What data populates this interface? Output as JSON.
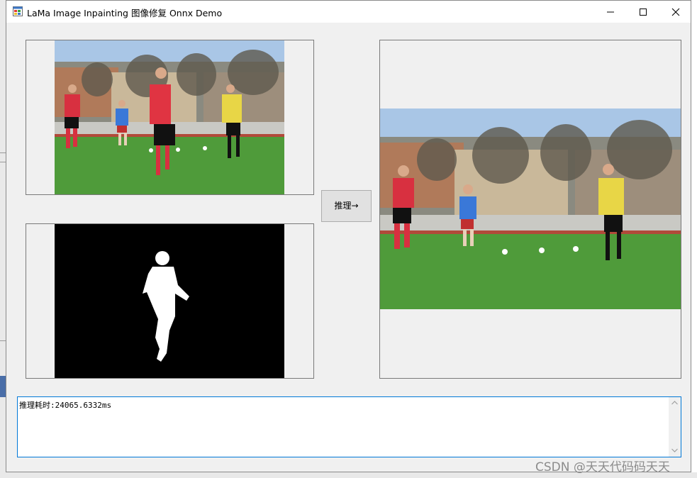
{
  "window": {
    "title": "LaMa Image Inpainting 图像修复 Onnx Demo",
    "icons": {
      "app": "app-window-icon",
      "minimize": "minimize-icon",
      "maximize": "maximize-icon",
      "close": "close-icon"
    }
  },
  "controls": {
    "infer_button_label": "推理→"
  },
  "log": {
    "text": "推理耗时:24065.6332ms"
  },
  "watermark": {
    "text": "CSDN @天天代码码天天"
  },
  "colors": {
    "window_bg": "#f0f0f0",
    "focus_border": "#0078d7",
    "grass": "#4e9a3a",
    "sky": "#9fc0e4"
  }
}
